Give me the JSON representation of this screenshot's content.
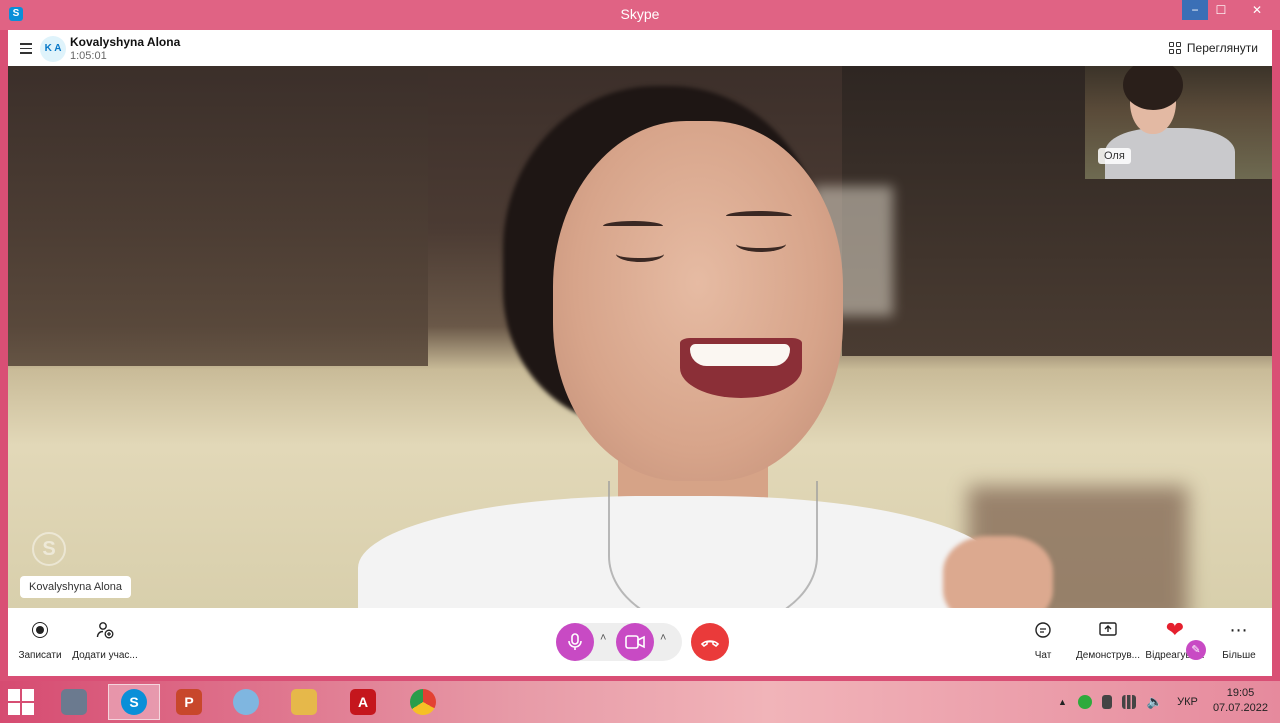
{
  "window": {
    "title": "Skype",
    "controls": {
      "minimize": "−",
      "maximize": "☐",
      "close": "✕"
    }
  },
  "call": {
    "avatar_initials": "K A",
    "name": "Kovalyshyna Alona",
    "duration": "1:05:01",
    "view_button": "Переглянути",
    "participant_tag": "Kovalyshyna Alona",
    "self_label": "Оля"
  },
  "toolbar": {
    "record": "Записати",
    "add_participant": "Додати учас...",
    "chat": "Чат",
    "share": "Демонструв...",
    "react": "Відреагува...",
    "more": "Більше",
    "mic_caret": "˄",
    "cam_caret": "˄"
  },
  "taskbar": {
    "apps": [
      {
        "name": "file-manager",
        "color": "#6b7a8f"
      },
      {
        "name": "skype",
        "label": "S",
        "color": "#0a8fd8",
        "active": true
      },
      {
        "name": "powerpoint",
        "label": "P",
        "color": "#c8472b"
      },
      {
        "name": "paint",
        "color": "#7fb6e0"
      },
      {
        "name": "explorer",
        "color": "#e6b84a"
      },
      {
        "name": "acrobat",
        "label": "A",
        "color": "#c5161d"
      },
      {
        "name": "chrome",
        "color": "#2a9d4b"
      }
    ],
    "language": "УКР",
    "time": "19:05",
    "date": "07.07.2022"
  },
  "colors": {
    "accent": "#c84ac4",
    "end_call": "#ea3a3a",
    "title_bar": "#e06384",
    "heart": "#e5202e"
  }
}
